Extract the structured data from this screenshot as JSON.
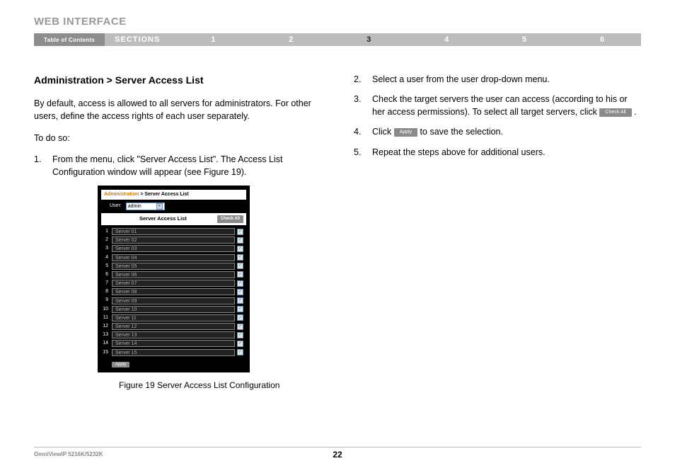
{
  "header": "WEB INTERFACE",
  "nav": {
    "toc": "Table of Contents",
    "sections_label": "SECTIONS",
    "items": [
      "1",
      "2",
      "3",
      "4",
      "5",
      "6"
    ],
    "active_index": 2
  },
  "left": {
    "heading": "Administration > Server Access List",
    "intro": "By default, access is allowed to all servers for administrators. For other users, define the access rights of each user separately.",
    "todo": "To do so:",
    "step1_num": "1.",
    "step1_txt": "From the menu, click \"Server Access List\". The Access List Configuration window will appear (see Figure 19)."
  },
  "right": {
    "step2_num": "2.",
    "step2_txt": "Select a user from the user drop-down menu.",
    "step3_num": "3.",
    "step3_txt_a": "Check the target servers the user can access (according to his or her access permissions). To select all target servers, click ",
    "step3_btn": "Check All",
    "step3_txt_b": " .",
    "step4_num": "4.",
    "step4_txt_a": "Click ",
    "step4_btn": "Apply",
    "step4_txt_b": " to save the selection.",
    "step5_num": "5.",
    "step5_txt": "Repeat the steps above for additional users."
  },
  "figure": {
    "breadcrumb_admin": "Administration",
    "breadcrumb_rest": " > Server Access List",
    "user_label": "User:",
    "user_value": "admin",
    "list_title": "Server Access List",
    "check_all": "Check All",
    "apply": "Apply",
    "servers": [
      {
        "n": "1",
        "name": "Server 01"
      },
      {
        "n": "2",
        "name": "Server 02"
      },
      {
        "n": "3",
        "name": "Server 03"
      },
      {
        "n": "4",
        "name": "Server 04"
      },
      {
        "n": "5",
        "name": "Server 05"
      },
      {
        "n": "6",
        "name": "Server 06"
      },
      {
        "n": "7",
        "name": "Server 07"
      },
      {
        "n": "8",
        "name": "Server 08"
      },
      {
        "n": "9",
        "name": "Server 09"
      },
      {
        "n": "10",
        "name": "Server 10"
      },
      {
        "n": "11",
        "name": "Server 11"
      },
      {
        "n": "12",
        "name": "Server 12"
      },
      {
        "n": "13",
        "name": "Server 13"
      },
      {
        "n": "14",
        "name": "Server 14"
      },
      {
        "n": "15",
        "name": "Server 15"
      }
    ],
    "caption": "Figure 19 Server Access List Configuration"
  },
  "footer": {
    "product": "OmniViewIP 5216K/5232K",
    "page": "22"
  }
}
